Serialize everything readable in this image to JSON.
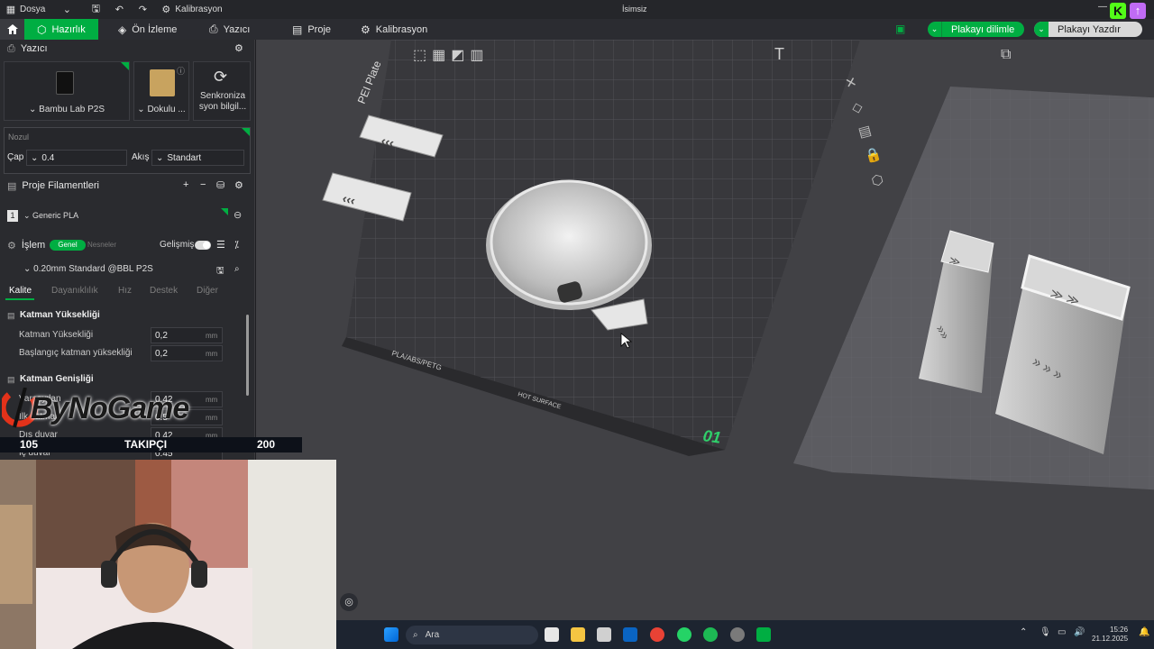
{
  "titlebar": {
    "file_menu": "Dosya",
    "calibration_menu": "Kalibrasyon",
    "window_title": "İsimsiz"
  },
  "tabs": [
    {
      "label": "Hazırlık"
    },
    {
      "label": "Ön İzleme"
    },
    {
      "label": "Yazıcı"
    },
    {
      "label": "Proje"
    },
    {
      "label": "Kalibrasyon"
    }
  ],
  "actions": {
    "slice_plate": "Plakayı dilimle",
    "print_plate": "Plakayı Yazdır"
  },
  "printer_panel": {
    "title": "Yazıcı",
    "printer_name": "Bambu Lab P2S",
    "plate_name": "Dokulu ...",
    "sync_label": "Senkroniza syon bilgil..."
  },
  "nozzle": {
    "section_label": "Nozul",
    "diameter_label": "Çap",
    "diameter_value": "0.4",
    "flow_label": "Akış",
    "flow_value": "Standart"
  },
  "filaments": {
    "title": "Proje Filamentleri",
    "items": [
      {
        "index": "1",
        "name": "Generic PLA"
      }
    ]
  },
  "process": {
    "title": "İşlem",
    "toggle_general": "Genel",
    "toggle_objects": "Nesneler",
    "advanced_label": "Gelişmiş",
    "preset": "0.20mm Standard @BBL P2S",
    "subtabs": [
      "Kalite",
      "Dayanıklılık",
      "Hız",
      "Destek",
      "Diğer"
    ],
    "layer_height_section": "Katman Yüksekliği",
    "layer_height_label": "Katman Yüksekliği",
    "layer_height_value": "0,2",
    "initial_layer_label": "Başlangıç katman yüksekliği",
    "initial_layer_value": "0,2",
    "unit": "mm",
    "line_width_section": "Katman Genişliği",
    "line_width_rows": [
      {
        "label": "Varsayılan",
        "value": "0.42"
      },
      {
        "label": "İlk katman",
        "value": "0.5"
      },
      {
        "label": "Dış duvar",
        "value": "0.42"
      },
      {
        "label": "İç duvar",
        "value": "0.45"
      }
    ]
  },
  "viewport": {
    "plate_label_top": "PEI Plate",
    "plate_label_bottom": "PLA/ABS/PETG",
    "hot_surface": "HOT SURFACE",
    "plate_number": "01"
  },
  "overlay": {
    "brand": "ByNoGame",
    "follow_current": "105",
    "follow_label": "TAKIPÇI",
    "follow_goal": "200"
  },
  "taskbar": {
    "search_placeholder": "Ara",
    "time": "15:26",
    "date": "21.12.2025"
  },
  "colors": {
    "accent": "#00ae42",
    "panel": "#2a2b2f",
    "viewport": "#414145"
  }
}
